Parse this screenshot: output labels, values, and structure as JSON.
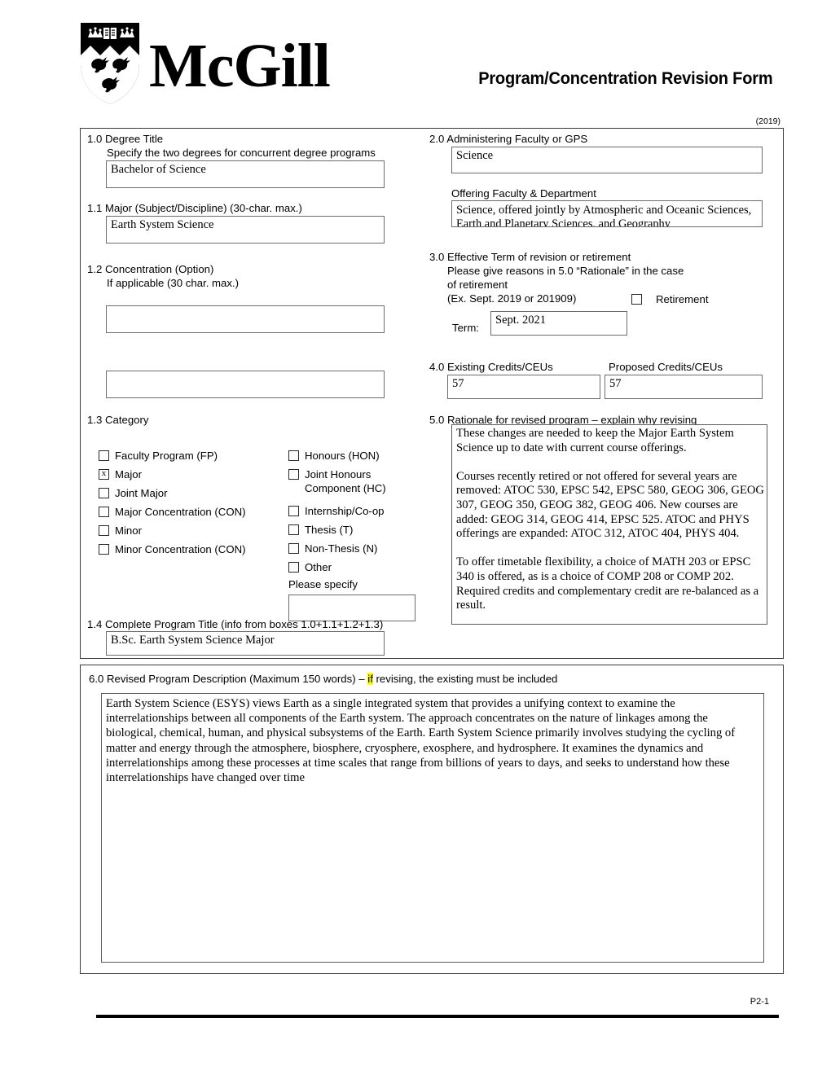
{
  "header": {
    "wordmark": "McGill",
    "form_title": "Program/Concentration Revision Form",
    "year_stamp": "(2019)",
    "shield_icon": "mcgill-shield-icon"
  },
  "section_1_0": {
    "number_label": "1.0 Degree Title",
    "hint": "Specify the two degrees for concurrent degree programs",
    "value": "Bachelor of Science"
  },
  "section_1_1": {
    "number_label": "1.1 Major (Subject/Discipline) (30-char. max.)",
    "value": "Earth System Science"
  },
  "section_1_2": {
    "number_label": "1.2 Concentration (Option)",
    "hint": "If applicable (30 char. max.)",
    "value_1": "",
    "value_2": ""
  },
  "section_1_3": {
    "number_label": "1.3 Category",
    "left_options": [
      {
        "label": "Faculty Program (FP)",
        "checked": false
      },
      {
        "label": "Major",
        "checked": true
      },
      {
        "label": "Joint Major",
        "checked": false
      },
      {
        "label": "Major Concentration (CON)",
        "checked": false
      },
      {
        "label": "Minor",
        "checked": false
      },
      {
        "label": "Minor Concentration (CON)",
        "checked": false
      }
    ],
    "right_options": [
      {
        "label": "Honours (HON)",
        "checked": false
      },
      {
        "label": "Joint Honours\nComponent (HC)",
        "checked": false
      },
      {
        "label": "Internship/Co-op",
        "checked": false
      },
      {
        "label": "Thesis (T)",
        "checked": false
      },
      {
        "label": "Non-Thesis (N)",
        "checked": false
      },
      {
        "label": "Other",
        "checked": false
      }
    ],
    "please_specify_label": "Please specify",
    "please_specify_value": ""
  },
  "section_1_4": {
    "number_label": "1.4 Complete Program Title (info from boxes 1.0+1.1+1.2+1.3)",
    "value": "B.Sc. Earth System Science Major"
  },
  "section_2_0": {
    "number_label": "2.0 Administering Faculty or GPS",
    "value": "Science",
    "offering_label": "Offering Faculty & Department",
    "offering_value": "Science, offered jointly by Atmospheric and Oceanic Sciences, Earth and Planetary Sciences, and Geography"
  },
  "section_3_0": {
    "number_label": "3.0 Effective Term of revision or retirement",
    "hint_line_1": "Please give reasons in 5.0 “Rationale” in the case",
    "hint_line_2": "of retirement",
    "hint_line_3": "(Ex. Sept. 2019 or 201909)",
    "retirement_label": "Retirement",
    "retirement_checked": false,
    "term_label": "Term:",
    "term_value": "Sept. 2021"
  },
  "section_4_0": {
    "existing_label": "4.0 Existing Credits/CEUs",
    "existing_value": "57",
    "proposed_label": "Proposed Credits/CEUs",
    "proposed_value": "57"
  },
  "section_5_0": {
    "number_label": "5.0 Rationale for revised program – explain why revising",
    "value": "These changes are needed to keep the Major Earth System Science up to date with current course offerings.\n\nCourses recently retired or not offered for several years are removed: ATOC 530, EPSC 542, EPSC 580, GEOG 306, GEOG 307, GEOG 350, GEOG 382, GEOG 406. New courses are added: GEOG 314, GEOG 414, EPSC 525. ATOC and PHYS offerings are expanded: ATOC 312, ATOC 404, PHYS 404.\n\nTo offer timetable flexibility, a choice of MATH 203 or EPSC 340 is offered, as is a choice of COMP 208 or COMP 202. Required credits and complementary credit are re-balanced as a result."
  },
  "section_6_0": {
    "heading_before": "6.0 Revised Program Description (Maximum 150 words) – ",
    "heading_highlight": "if",
    "heading_after": " revising, the existing must be included",
    "value": "Earth System Science (ESYS) views Earth as a single integrated system that provides a unifying context to examine the interrelationships between all components of the Earth system. The approach concentrates on the nature of linkages among the biological, chemical, human, and physical subsystems of the Earth. Earth System Science primarily involves studying the cycling of matter and energy through the atmosphere, biosphere, cryosphere, exosphere, and hydrosphere. It examines the dynamics and interrelationships among these processes at time scales that range from billions of years to days, and seeks to understand how these interrelationships have changed over time"
  },
  "footer": {
    "page_number": "P2-1"
  }
}
